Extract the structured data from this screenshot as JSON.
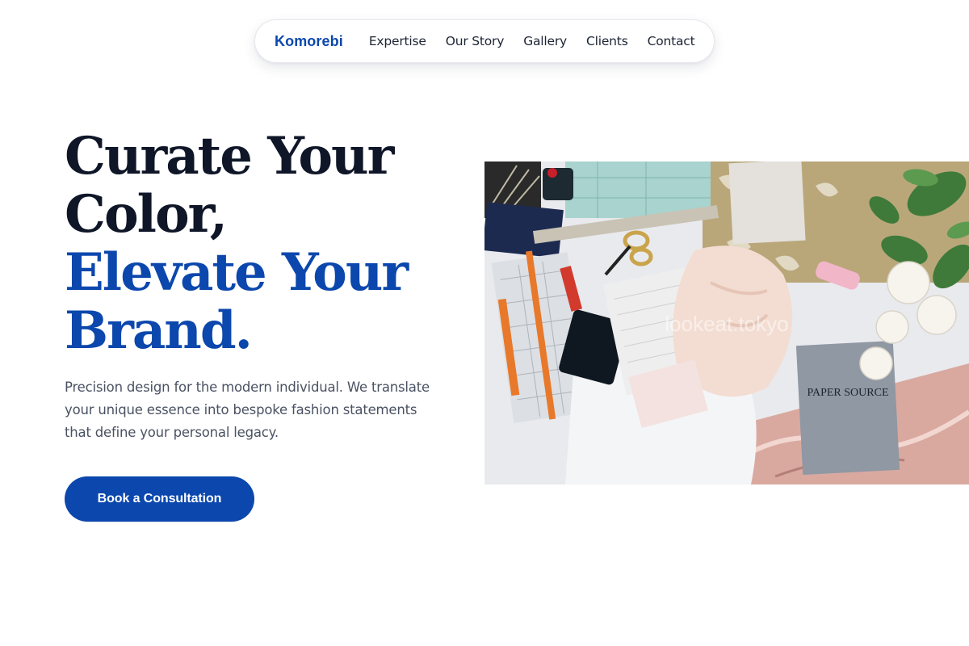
{
  "nav": {
    "brand": "Komorebi",
    "links": [
      {
        "label": "Expertise"
      },
      {
        "label": "Our Story"
      },
      {
        "label": "Gallery"
      },
      {
        "label": "Clients"
      },
      {
        "label": "Contact"
      }
    ]
  },
  "hero": {
    "title_lines": [
      "Curate Your",
      "Color,"
    ],
    "title_accent_lines": [
      "Elevate Your",
      "Brand."
    ],
    "description": "Precision design for the modern individual. We translate your unique essence into bespoke fashion statements that define your personal legacy.",
    "cta_label": "Book a Consultation"
  },
  "image": {
    "watermark": "lookeat.tokyo",
    "book_title": "PAPER SOURCE"
  },
  "colors": {
    "accent": "#0b47ad",
    "heading": "#0f1628",
    "body_text": "#4a5262",
    "nav_text": "#1c2433",
    "background": "#ffffff"
  }
}
